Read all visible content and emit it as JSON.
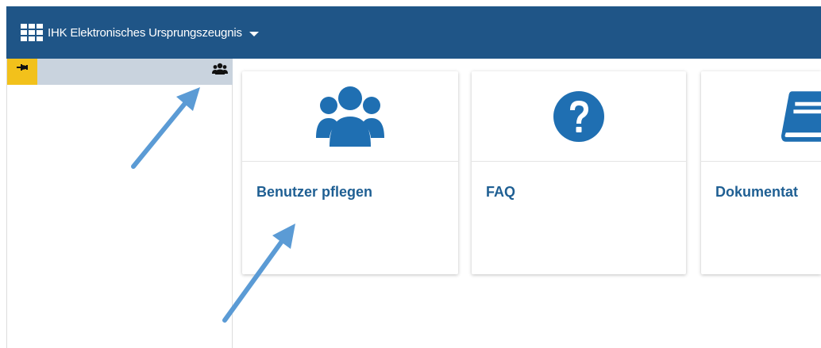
{
  "header": {
    "app_title": "IHK Elektronisches Ursprungszeugnis",
    "menu_icon": "app-grid-icon",
    "dropdown_icon": "caret-down-icon"
  },
  "sidebar": {
    "pin_icon": "pin-icon",
    "group_icon": "users-icon"
  },
  "tiles": [
    {
      "label": "Benutzer pflegen",
      "icon": "users-icon"
    },
    {
      "label": "FAQ",
      "icon": "question-circle-icon"
    },
    {
      "label": "Dokumentat",
      "icon": "book-icon"
    }
  ],
  "annotations": [
    {
      "kind": "arrow",
      "color": "#5b9bd5",
      "points_to": "sidebar users icon"
    },
    {
      "kind": "arrow",
      "color": "#5b9bd5",
      "points_to": "Benutzer pflegen tile"
    }
  ],
  "colors": {
    "header_bg": "#1f5587",
    "tile_accent": "#1f6fb2",
    "label_text": "#1f5f93",
    "pin_bg": "#f2c11b",
    "sidebar_bar": "#c9d3de",
    "annotation_arrow": "#5b9bd5"
  }
}
